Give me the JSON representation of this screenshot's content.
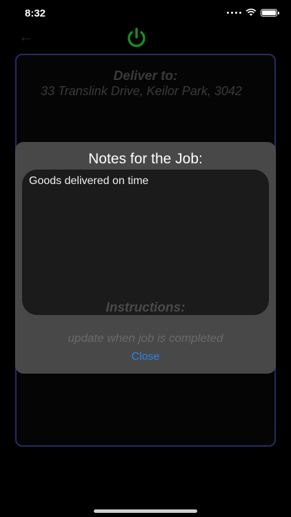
{
  "status_bar": {
    "time": "8:32"
  },
  "header": {
    "back_icon": "left-arrow-icon",
    "power_icon": "power-icon",
    "accent_color": "#1e8a1e"
  },
  "background_card": {
    "deliver_heading": "Deliver to:",
    "address": "33 Translink Drive, Keilor Park, 3042",
    "instructions_heading": "Instructions:",
    "instructions_text": "update when job is completed"
  },
  "modal": {
    "title": "Notes for the Job:",
    "notes": "Goods delivered on time",
    "close_label": "Close",
    "close_color": "#2e82e6"
  }
}
